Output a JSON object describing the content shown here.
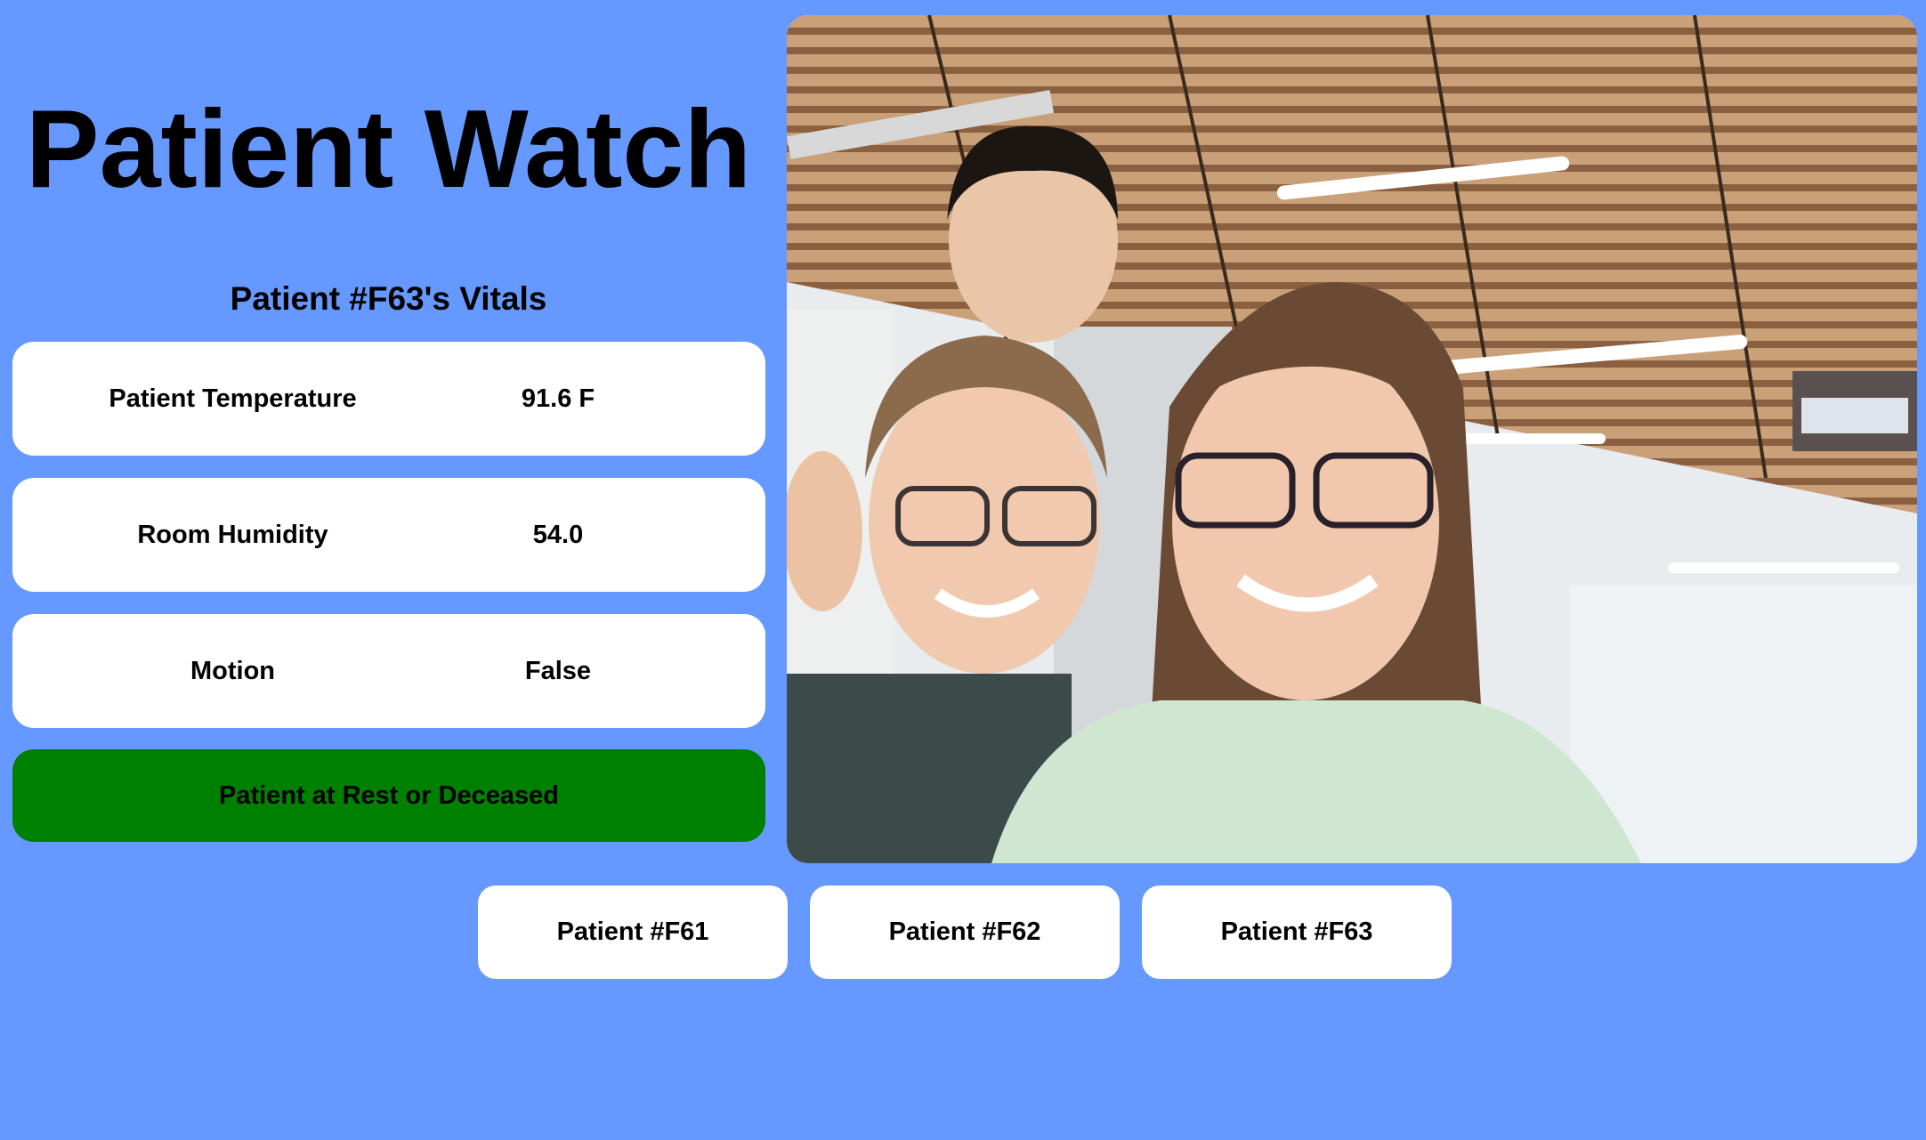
{
  "app": {
    "title": "Patient Watch"
  },
  "vitals": {
    "heading": "Patient #F63's Vitals",
    "items": [
      {
        "label": "Patient Temperature",
        "value": "91.6 F"
      },
      {
        "label": "Room Humidity",
        "value": "54.0"
      },
      {
        "label": "Motion",
        "value": "False"
      }
    ],
    "status": {
      "text": "Patient at Rest or Deceased",
      "color": "#008000"
    }
  },
  "patient_tabs": [
    {
      "label": "Patient #F61"
    },
    {
      "label": "Patient #F62"
    },
    {
      "label": "Patient #F63"
    }
  ],
  "theme": {
    "background": "#6699ff",
    "card": "#ffffff"
  }
}
